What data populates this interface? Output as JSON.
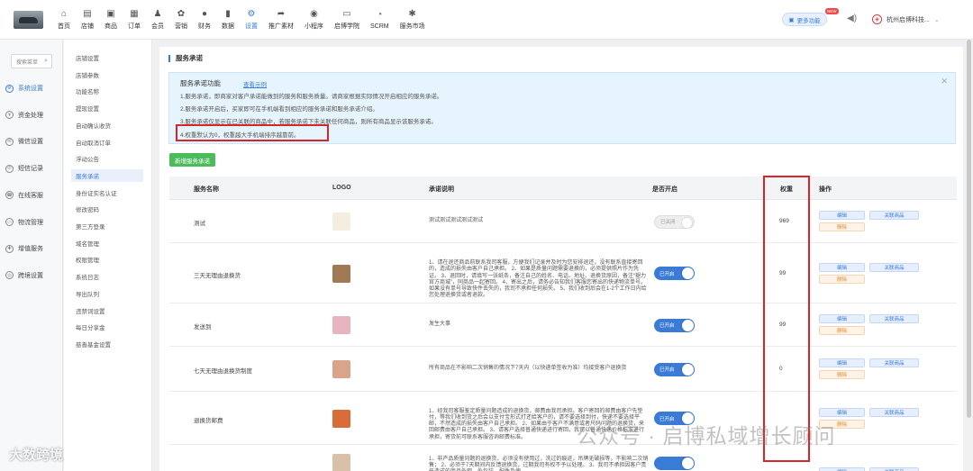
{
  "nav": [
    {
      "label": "首页",
      "icon": "home-icon",
      "glyph": "⌂"
    },
    {
      "label": "店铺",
      "icon": "store-icon",
      "glyph": "▤"
    },
    {
      "label": "商品",
      "icon": "goods-icon",
      "glyph": "▣"
    },
    {
      "label": "订单",
      "icon": "order-icon",
      "glyph": "▦"
    },
    {
      "label": "会员",
      "icon": "member-icon",
      "glyph": "♟"
    },
    {
      "label": "营销",
      "icon": "marketing-icon",
      "glyph": "✿"
    },
    {
      "label": "财务",
      "icon": "finance-icon",
      "glyph": "●"
    },
    {
      "label": "数据",
      "icon": "data-icon",
      "glyph": "▮"
    },
    {
      "label": "设置",
      "icon": "settings-icon",
      "glyph": "⚙"
    },
    {
      "label": "推广素材",
      "icon": "share-icon",
      "glyph": "➦"
    },
    {
      "label": "小程序",
      "icon": "miniapp-icon",
      "glyph": "◉"
    },
    {
      "label": "启博学院",
      "icon": "academy-icon",
      "glyph": "▭"
    },
    {
      "label": "SCRM",
      "icon": "scrm-icon",
      "glyph": "◔"
    },
    {
      "label": "服务市场",
      "icon": "market-icon",
      "glyph": "✱"
    }
  ],
  "active_nav": "设置",
  "header": {
    "more_label": "更多功能",
    "new_badge": "NEW",
    "shop_name": "杭州启博科技..."
  },
  "search": {
    "placeholder": "搜索菜单"
  },
  "sidebar": [
    {
      "label": "系统设置",
      "icon": "system-settings-icon",
      "active": true
    },
    {
      "label": "资金处理",
      "icon": "funds-icon"
    },
    {
      "label": "微信设置",
      "icon": "wechat-icon"
    },
    {
      "label": "短信记录",
      "icon": "sms-icon"
    },
    {
      "label": "在线客服",
      "icon": "service-icon"
    },
    {
      "label": "物流管理",
      "icon": "logistics-icon"
    },
    {
      "label": "增值服务",
      "icon": "value-added-icon"
    },
    {
      "label": "跨境设置",
      "icon": "cross-border-icon"
    }
  ],
  "submenu": [
    "店铺设置",
    "店铺参数",
    "功能名称",
    "提现设置",
    "自动确认收货",
    "自动取消订单",
    "浮动公告",
    "服务承诺",
    "身份证实名认证",
    "修改密码",
    "第三方登录",
    "域名管理",
    "权限管理",
    "系统日志",
    "导出队列",
    "违禁词设置",
    "每日分享金",
    "慈善基金设置"
  ],
  "submenu_active": "服务承诺",
  "page": {
    "title": "服务承诺",
    "add_button": "新增服务承诺"
  },
  "notice": {
    "heading": "服务承诺功能",
    "link": "查看示例",
    "lines": [
      "1.服务承诺，即商家对客户承诺能做到的服务和服务质量。请商家根据实际情况开启相应的服务承诺。",
      "2.服务承诺开启后，买家即可在手机端看到相应的服务承诺和服务承诺介绍。",
      "3.服务承诺仅显示在已关联的商品中，若服务承诺下未关联任何商品，则所有商品显示该服务承诺。",
      "4.权重默认为0，权重越大手机端排序越靠前。"
    ]
  },
  "table": {
    "headers": {
      "name": "服务名称",
      "logo": "LOGO",
      "desc": "承诺说明",
      "enabled": "是否开启",
      "weight": "权重",
      "ops": "操作"
    },
    "rows": [
      {
        "name": "测试",
        "desc": "测试测试测试测试测试",
        "toggle": "已关闭",
        "on": false,
        "weight": "969",
        "logo_color": "#f5ede0"
      },
      {
        "name": "三天无理由退换货",
        "desc": "1、请在退还商品前联系我司客服，方便我们记录并及时为您安排退还，没有联系直接寄回的，造成的损失由客户自己承担。 2、如果是质量问题需要退换的，必须提供照片作为凭证。 3、退回时，请填写一张纸条，备注自己的姓名、电话、地址、退换货原因，备注“褪力官方商城”，同商品一起寄回。 4、寄出之后，请务必告知我们客服您寄出的快递物流单号。如果没有单号导致快件丢失的，我司不承担任何损失。 5、我们收到后会在1-2个工作日内给您处理退换货或者退款。",
        "toggle": "已开启",
        "on": true,
        "weight": "99",
        "logo_color": "#a07a55"
      },
      {
        "name": "发送到",
        "desc": "发生大事",
        "toggle": "已开启",
        "on": true,
        "weight": "99",
        "logo_color": "#e8b4bf"
      },
      {
        "name": "七天无理由退换货制度",
        "desc": "所有商品在不影响二次销售的情况下7天内（以快递单签收为准）均接受客户退换货",
        "toggle": "已开启",
        "on": true,
        "weight": "0",
        "logo_color": "#d9a58a"
      },
      {
        "name": "退换货邮费",
        "desc": "1、经我司客服鉴定质量问题造成的退换货，邮费由我司承担。客户寄回的邮费由客户先垫付，等我们收到货之后会以支付宝形式打还给客户的，请不要选择到付，快递不要选择平邮，不然造成的损失由客户自己承担。 2、如果由于客户不满意或者尺码问题的退换货，来回邮费由客户自己承担。 3、请客户选择普通快递进行寄回，我司以普通快递价格标准进行承担，寄货前可联系客服咨询邮费标准。",
        "toggle": "已开启",
        "on": true,
        "weight": "",
        "logo_color": "#d96d3a"
      },
      {
        "name": "",
        "desc": "1、非产品质量问题的退换货，必须没有使用过，洗过的痕迹，吊牌无破损等，不影响二次销售； 2、必须于7天期间内反馈退换货，过期我司有权不予以处理。 3、我司不承担因客户责任造成的商品外观、外包装、配件及使",
        "toggle": "",
        "on": true,
        "weight": "",
        "logo_color": "#d8c1a8"
      }
    ],
    "op_labels": {
      "edit": "编辑",
      "link": "关联商品",
      "delete": "删除"
    }
  },
  "watermarks": {
    "left": "大数跨境",
    "right": "公众号 · 启博私域增长顾问"
  }
}
